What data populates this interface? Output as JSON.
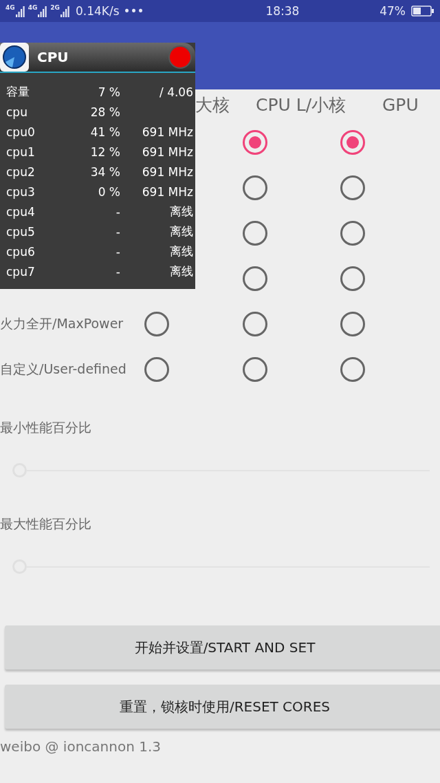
{
  "status_bar": {
    "networks": [
      {
        "label": "4G"
      },
      {
        "label": "4G"
      },
      {
        "label": "2G"
      }
    ],
    "speed": "0.14K/s",
    "more": "•••",
    "time": "18:38",
    "battery": "47%"
  },
  "columns": [
    "大核",
    "CPU L/小核",
    "GPU"
  ],
  "modes": [
    {
      "l": {
        "selected": true
      },
      "gpu": {
        "selected": true
      }
    },
    {
      "l": {
        "selected": false
      },
      "gpu": {
        "selected": false
      }
    },
    {
      "l": {
        "selected": false
      },
      "gpu": {
        "selected": false
      }
    },
    {
      "l": {
        "selected": false
      },
      "gpu": {
        "selected": false
      }
    },
    {
      "label": "火力全开/MaxPower",
      "b": {
        "selected": false
      },
      "l": {
        "selected": false
      },
      "gpu": {
        "selected": false
      }
    },
    {
      "label": "自定义/User-defined",
      "b": {
        "selected": false
      },
      "l": {
        "selected": false
      },
      "gpu": {
        "selected": false
      }
    }
  ],
  "sliders": [
    {
      "label": "最小性能百分比",
      "level": 0
    },
    {
      "label": "最大性能百分比",
      "level": 0
    }
  ],
  "buttons": [
    "开始并设置/START AND SET",
    "重置，锁核时使用/RESET CORES"
  ],
  "footer": "weibo @ ioncannon 1.3",
  "monitor": {
    "title": "CPU",
    "rows": [
      {
        "name": "容量",
        "usage": "7 %",
        "freq": "/ 4.06"
      },
      {
        "name": "cpu",
        "usage": "28 %"
      },
      {
        "name": "cpu0",
        "usage": "41 %",
        "freq": "691 MHz"
      },
      {
        "name": "cpu1",
        "usage": "12 %",
        "freq": "691 MHz"
      },
      {
        "name": "cpu2",
        "usage": "34 %",
        "freq": "691 MHz"
      },
      {
        "name": "cpu3",
        "usage": "0 %",
        "freq": "691 MHz"
      },
      {
        "name": "cpu4",
        "usage": "-",
        "freq": "离线"
      },
      {
        "name": "cpu5",
        "usage": "-",
        "freq": "离线"
      },
      {
        "name": "cpu6",
        "usage": "-",
        "freq": "离线"
      },
      {
        "name": "cpu7",
        "usage": "-",
        "freq": "离线"
      }
    ]
  }
}
